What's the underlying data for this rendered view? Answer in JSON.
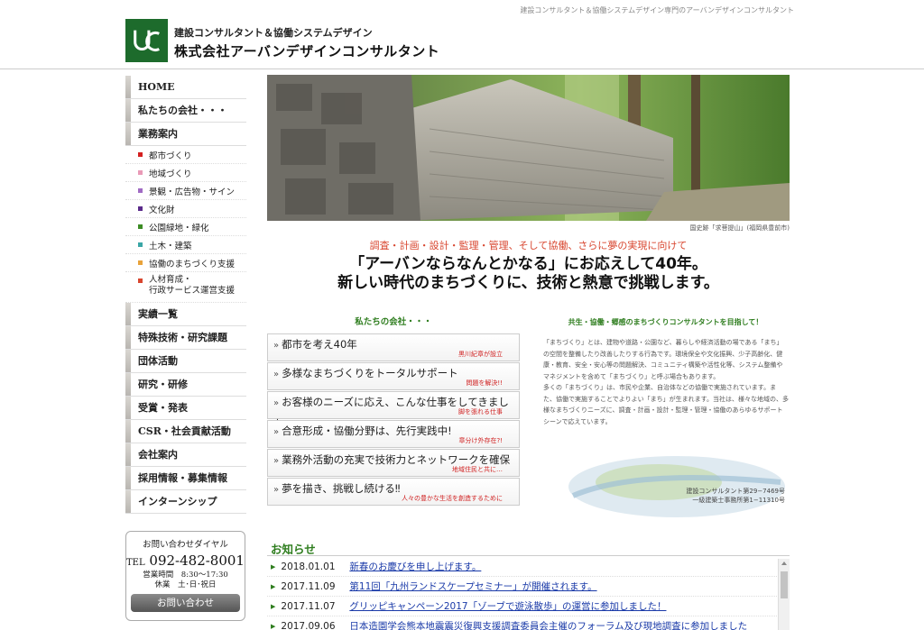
{
  "header": {
    "topline": "建設コンサルタント＆協働システムデザイン専門のアーバンデザインコンサルタント",
    "subtitle": "建設コンサルタント＆協働システムデザイン",
    "company": "株式会社アーバンデザインコンサルタント",
    "brand_color": "#1d6b2c"
  },
  "sidebar": {
    "items": [
      {
        "label": "HOME"
      },
      {
        "label": "私たちの会社・・・"
      },
      {
        "label": "業務案内"
      }
    ],
    "subitems": [
      {
        "label": "都市づくり",
        "color": "#d42020"
      },
      {
        "label": "地域づくり",
        "color": "#e99ab7"
      },
      {
        "label": "景観・広告物・サイン",
        "color": "#a06bc4"
      },
      {
        "label": "文化財",
        "color": "#5a2a8a"
      },
      {
        "label": "公園緑地・緑化",
        "color": "#3c8c24"
      },
      {
        "label": "土木・建築",
        "color": "#3aa6a6"
      },
      {
        "label": "協働のまちづくり支援",
        "color": "#e8a23a"
      },
      {
        "label": "人材育成・",
        "label2": "行政サービス運営支援",
        "color": "#d8452e"
      }
    ],
    "items2": [
      {
        "label": "実績一覧"
      },
      {
        "label": "特殊技術・研究課題"
      },
      {
        "label": "団体活動"
      },
      {
        "label": "研究・研修"
      },
      {
        "label": "受賞・発表"
      },
      {
        "label": "CSR・社会貢献活動"
      },
      {
        "label": "会社案内"
      },
      {
        "label": "採用情報・募集情報"
      },
      {
        "label": "インターンシップ"
      }
    ]
  },
  "contact": {
    "title": "お問い合わせダイヤル",
    "tel_prefix": "TEL",
    "tel": "092-482-8001",
    "hours": "営業時間　8:30～17:30",
    "holiday": "休業　土･日･祝日",
    "button": "お問い合わせ"
  },
  "hero": {
    "caption": "国史跡「求菩提山」(福岡県豊前市)"
  },
  "tagline": "調査・計画・設計・監理・管理、そして協働、さらに夢の実現に向けて",
  "headline1": "「アーバンならなんとかなる」にお応えして40年。",
  "headline2": "新しい時代のまちづくりに、技術と熱意で挑戦します。",
  "company_section": {
    "title": "私たちの会社・・・",
    "links": [
      {
        "title": "都市を考え40年",
        "sub": "黒川紀章が設立"
      },
      {
        "title": "多様なまちづくりをトータルサポート",
        "sub": "問題を解決!!"
      },
      {
        "title": "お客様のニーズに応え、こんな仕事をしてきました",
        "sub": "脚を張れる仕事"
      },
      {
        "title": "合意形成・協働分野は、先行実践中!",
        "sub": "章分け外存在?!"
      },
      {
        "title": "業務外活動の充実で技術力とネットワークを確保",
        "sub": "地域住民と共に…"
      },
      {
        "title": "夢を描き、挑戦し続ける‼",
        "sub": "人々の豊かな生活を創造するために"
      }
    ]
  },
  "about": {
    "title": "共生・協働・郷感のまちづくりコンサルタントを目指して！",
    "p1": "「まちづくり」とは、建物や道路・公園など、暮らしや経済活動の場である「まち」の空間を整備したり改善したりする行為です。環境保全や文化振興、少子高齢化、健康・教育、安全・安心等の問題解決、コミュニティ構築や活性化等、システム整備やマネジメントを含めて「まちづくり」と呼ぶ場合もあります。",
    "p2": "多くの「まちづくり」は、市民や企業、自治体などの協働で実施されています。また、協働で実施することでよりよい「まち」が生まれます。当社は、様々な地域の、多様なまちづくりニーズに、調査・計画・設計・監理・管理・協働のあらゆるサポートシーンで応えています。",
    "reg1": "建設コンサルタント第29−7469号",
    "reg2": "一級建築士事務所第1−11310号"
  },
  "news": {
    "title": "お知らせ",
    "items": [
      {
        "date": "2018.01.01",
        "text": "新春のお慶びを申し上げます。"
      },
      {
        "date": "2017.11.09",
        "text": "第11回「九州ランドスケープセミナー」が開催されます。"
      },
      {
        "date": "2017.11.07",
        "text": "グリッピキャンペーン2017「ゾーブで遊泳散歩」の運営に参加しました！"
      },
      {
        "date": "2017.09.06",
        "text": "日本造園学会熊本地震震災復興支援調査委員会主催のフォーラム及び現地調査に参加しました"
      }
    ]
  }
}
